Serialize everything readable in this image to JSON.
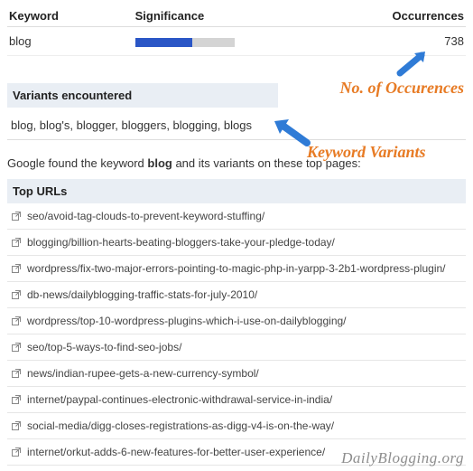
{
  "table": {
    "headers": {
      "keyword": "Keyword",
      "significance": "Significance",
      "occurrences": "Occurrences"
    },
    "row": {
      "keyword": "blog",
      "occurrences": "738",
      "significance_pct": 58
    }
  },
  "variants": {
    "heading": "Variants encountered",
    "list": "blog, blog's, blogger, bloggers, blogging, blogs"
  },
  "found_text": {
    "pre": "Google found the keyword ",
    "kw": "blog",
    "post": " and its variants on these top pages:"
  },
  "top_urls": {
    "heading": "Top URLs",
    "items": [
      "seo/avoid-tag-clouds-to-prevent-keyword-stuffing/",
      "blogging/billion-hearts-beating-bloggers-take-your-pledge-today/",
      "wordpress/fix-two-major-errors-pointing-to-magic-php-in-yarpp-3-2b1-wordpress-plugin/",
      "db-news/dailyblogging-traffic-stats-for-july-2010/",
      "wordpress/top-10-wordpress-plugins-which-i-use-on-dailyblogging/",
      "seo/top-5-ways-to-find-seo-jobs/",
      "news/indian-rupee-gets-a-new-currency-symbol/",
      "internet/paypal-continues-electronic-withdrawal-service-in-india/",
      "social-media/digg-closes-registrations-as-digg-v4-is-on-the-way/",
      "internet/orkut-adds-6-new-features-for-better-user-experience/"
    ]
  },
  "annotations": {
    "occurrences": "No. of Occurences",
    "variants": "Keyword Variants"
  },
  "watermark": "DailyBlogging.org"
}
